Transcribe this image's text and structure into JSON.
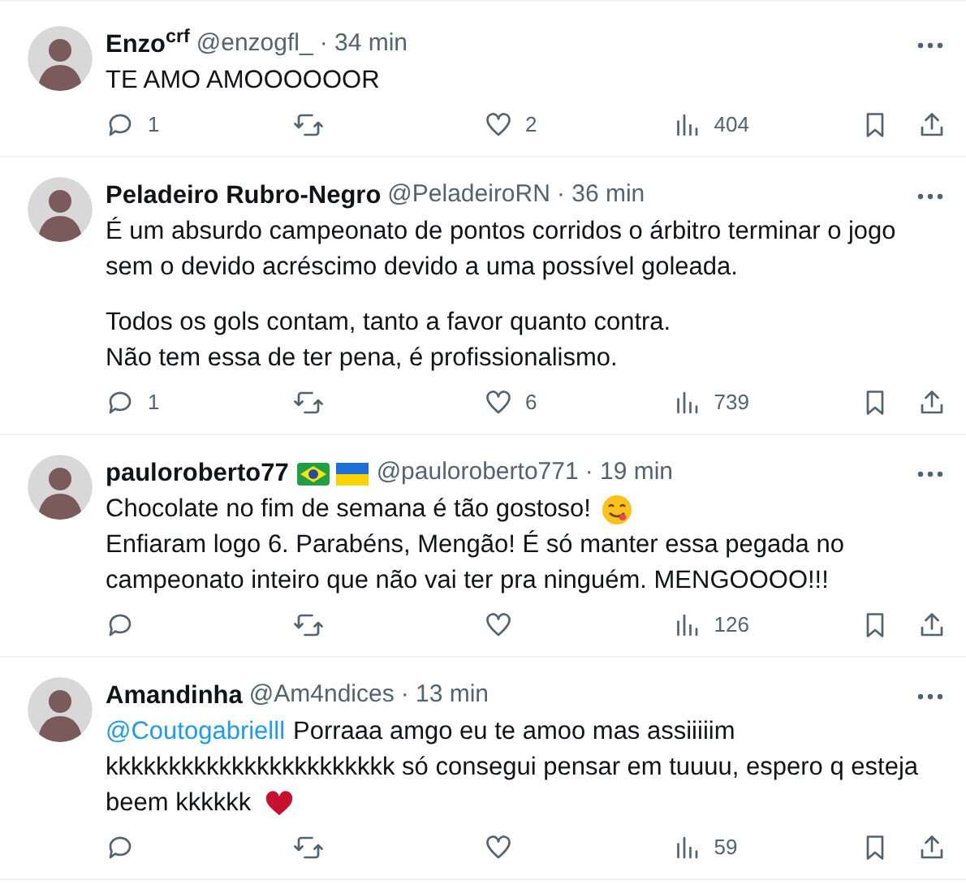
{
  "tweets": [
    {
      "name": "Enzo$^{crf}$",
      "handle": "@enzogfl_",
      "time": "· 34 min",
      "body": [
        [
          [
            {
              "kind": "text",
              "text": "TE AMO AMOOOOOOR"
            }
          ]
        ]
      ],
      "actions": {
        "replies": "1",
        "likes": "2",
        "views": "404"
      }
    },
    {
      "name": "Peladeiro Rubro-Negro",
      "handle": "@PeladeiroRN",
      "time": "· 36 min",
      "body": [
        [
          [
            {
              "kind": "text",
              "text": "É um absurdo campeonato de pontos corridos o árbitro terminar o jogo"
            }
          ],
          [
            {
              "kind": "text",
              "text": "sem o devido acréscimo devido a uma possível goleada."
            }
          ]
        ],
        [
          [
            {
              "kind": "text",
              "text": "Todos os gols contam, tanto a favor quanto contra."
            }
          ],
          [
            {
              "kind": "text",
              "text": "Não tem essa de ter pena, é profissionalismo."
            }
          ]
        ]
      ],
      "actions": {
        "replies": "1",
        "likes": "6",
        "views": "739"
      }
    },
    {
      "name": "pauloroberto77",
      "flags": [
        {
          "kind": "brazil"
        },
        {
          "kind": "ukraine"
        }
      ],
      "handle": "@pauloroberto771",
      "time": "· 19 min",
      "body": [
        [
          [
            {
              "kind": "text",
              "text": "Chocolate no fim de semana é tão gostoso!"
            },
            {
              "kind": "yum"
            }
          ],
          [
            {
              "kind": "text",
              "text": "Enfiaram logo 6. Parabéns, Mengão! É só manter essa pegada no"
            }
          ],
          [
            {
              "kind": "text",
              "text": "campeonato inteiro que não vai ter pra ninguém. MENGOOOO!!!"
            }
          ]
        ]
      ],
      "actions": {
        "views": "126"
      }
    },
    {
      "name": "Amandinha",
      "handle": "@Am4ndices",
      "time": "· 13 min",
      "body": [
        [
          [
            {
              "kind": "mention",
              "text": "@Coutogabrielll"
            },
            {
              "kind": "text",
              "text": "Porraaa amgo eu te amoo mas assiiiiim"
            }
          ],
          [
            {
              "kind": "text",
              "text": "kkkkkkkkkkkkkkkkkkkkkkk só consegui pensar em tuuuu, espero q esteja"
            }
          ],
          [
            {
              "kind": "text",
              "text": "beem kkkkkk"
            },
            {
              "kind": "heart"
            }
          ]
        ]
      ],
      "actions": {
        "views": "59"
      }
    }
  ]
}
